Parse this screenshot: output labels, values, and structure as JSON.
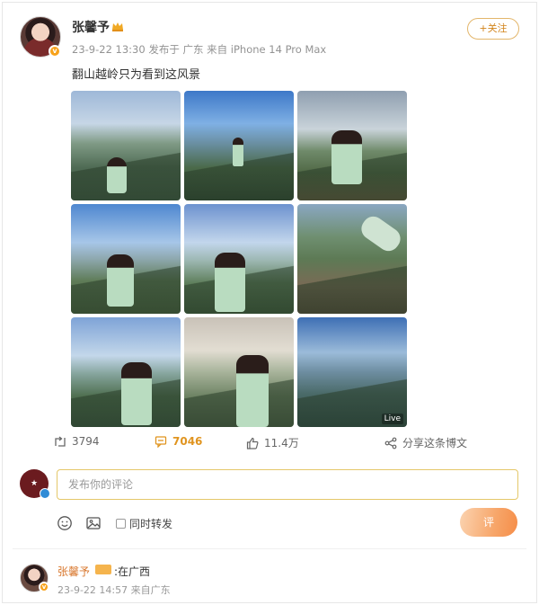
{
  "post": {
    "username": "张馨予",
    "meta": "23-9-22 13:30  发布于 广东  来自 iPhone 14 Pro Max",
    "follow_label": "+关注",
    "text": "翻山越岭只为看到这风景",
    "live_label": "Live"
  },
  "actions": {
    "repost_count": "3794",
    "comment_count": "7046",
    "like_count": "11.4万",
    "share_label": "分享这条博文"
  },
  "comment_box": {
    "placeholder": "发布你的评论",
    "repost_option": "同时转发",
    "submit_label": "评"
  },
  "reply": {
    "username": "张馨予",
    "text": ":在广西",
    "meta": "23-9-22 14:57  来自广东"
  },
  "colors": {
    "accent": "#d2841b",
    "badge": "#f7a21b",
    "comment_count": "#e0941f"
  }
}
